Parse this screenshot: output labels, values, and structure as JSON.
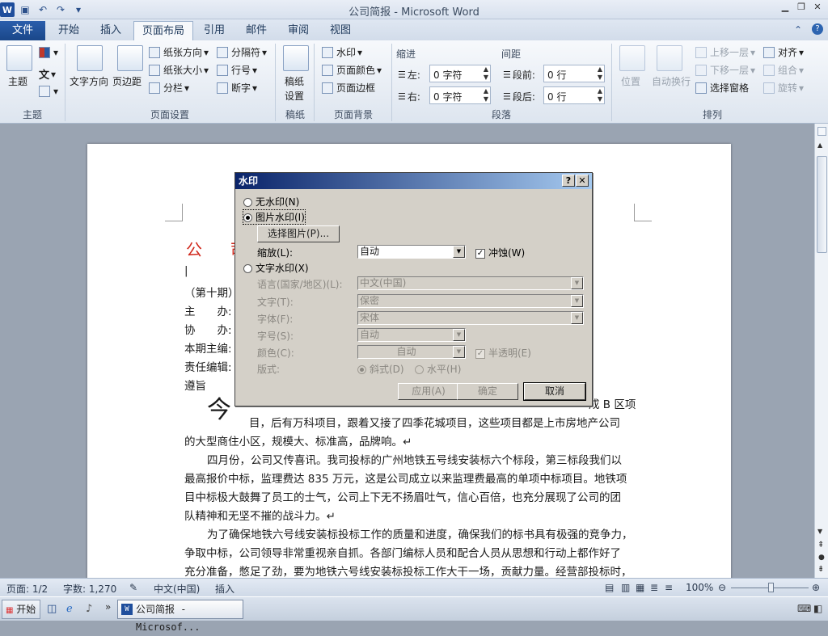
{
  "window": {
    "title": "公司简报 - Microsoft Word"
  },
  "tabs": [
    "文件",
    "开始",
    "插入",
    "页面布局",
    "引用",
    "邮件",
    "审阅",
    "视图"
  ],
  "ribbon": {
    "theme": {
      "label": "主题",
      "group": "主题"
    },
    "page_setup": {
      "text_direction": "文字方向",
      "margins": "页边距",
      "orientation": "纸张方向",
      "size": "纸张大小",
      "columns": "分栏",
      "breaks": "分隔符",
      "line_numbers": "行号",
      "hyphenation": "断字",
      "group": "页面设置"
    },
    "draft": {
      "label1": "稿纸",
      "label2": "设置",
      "group": "稿纸"
    },
    "background": {
      "watermark": "水印",
      "page_color": "页面颜色",
      "page_border": "页面边框",
      "group": "页面背景"
    },
    "paragraph": {
      "indent": "缩进",
      "spacing": "间距",
      "left_label": "左:",
      "left_value": "0 字符",
      "right_label": "右:",
      "right_value": "0 字符",
      "before_label": "段前:",
      "before_value": "0 行",
      "after_label": "段后:",
      "after_value": "0 行",
      "group": "段落"
    },
    "arrange": {
      "position": "位置",
      "wrap": "自动换行",
      "forward": "上移一层",
      "backward": "下移一层",
      "selection": "选择窗格",
      "align": "对齐",
      "group_btn": "组合",
      "rotate": "旋转",
      "group": "排列"
    }
  },
  "document": {
    "title_partial": "公 司",
    "lines": [
      "（第十期）",
      "主　　办:",
      "协　　办:",
      "本期主编:",
      "责任编辑:",
      "遵旨"
    ],
    "big_char": "今",
    "p1_right": "成 B 区项",
    "p1_l2": "目，后有万科项目，跟着又接了四季花城项目，这些项目都是上市房地产公司",
    "p1_l3": "的大型商住小区，规模大、标准高，品牌响。↵",
    "p2_l1": "四月份，公司又传喜讯。我司投标的广州地铁五号线安装标六个标段，第三标段我们以",
    "p2_l2": "最高报价中标，监理费达 835 万元，这是公司成立以来监理费最高的单项中标项目。地铁项",
    "p2_l3": "目中标极大鼓舞了员工的士气，公司上下无不扬眉吐气，信心百倍，也充分展现了公司的团",
    "p2_l4": "队精神和无坚不摧的战斗力。↵",
    "p3_l1": "为了确保地铁六号线安装标投标工作的质量和进度，确保我们的标书具有极强的竞争力，",
    "p3_l2": "争取中标，公司领导非常重视亲自抓。各部门编标人员和配合人员从思想和行动上都作好了",
    "p3_l3": "充分准备，憋足了劲，要为地铁六号线安装标投标工作大干一场，贡献力量。经营部投标时，"
  },
  "dialog": {
    "title": "水印",
    "help": "?",
    "close": "✕",
    "no_watermark": "无水印(N)",
    "picture_watermark": "图片水印(I)",
    "select_picture": "选择图片(P)...",
    "scale_label": "缩放(L):",
    "scale_value": "自动",
    "washout_label": "冲蚀(W)",
    "text_watermark": "文字水印(X)",
    "language_label": "语言(国家/地区)(L):",
    "language_value": "中文(中国)",
    "text_label": "文字(T):",
    "text_value": "保密",
    "font_label": "字体(F):",
    "font_value": "宋体",
    "size_label": "字号(S):",
    "size_value": "自动",
    "color_label": "颜色(C):",
    "color_value": "自动",
    "semitransparent_label": "半透明(E)",
    "layout_label": "版式:",
    "diagonal_label": "斜式(D)",
    "horizontal_label": "水平(H)",
    "apply": "应用(A)",
    "ok": "确定",
    "cancel": "取消"
  },
  "status": {
    "page": "页面: 1/2",
    "words": "字数: 1,270",
    "language": "中文(中国)",
    "insert": "插入",
    "zoom": "100%"
  },
  "taskbar": {
    "start": "开始",
    "item": "公司简报 - Microsof..."
  }
}
